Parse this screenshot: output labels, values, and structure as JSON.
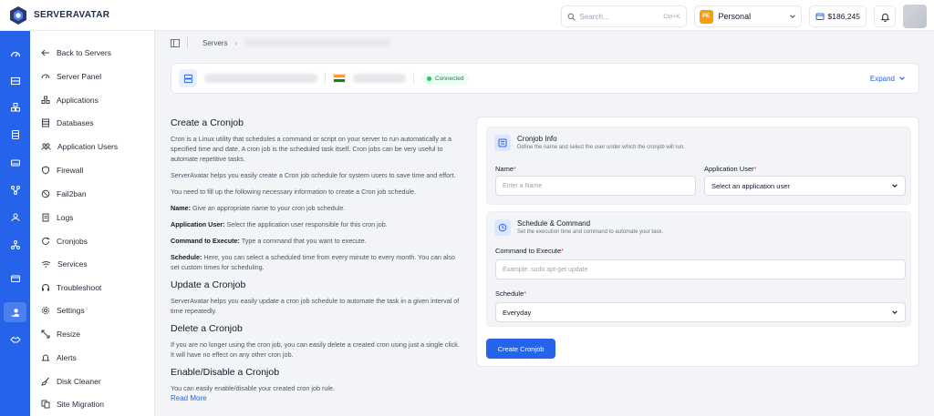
{
  "brand": {
    "name": "SERVERAVATAR"
  },
  "header": {
    "search_placeholder": "Search...",
    "search_shortcut": "Ctrl+K",
    "workspace_badge": "PE",
    "workspace_name": "Personal",
    "balance": "$186,245"
  },
  "rail": {
    "icons": [
      "dashboard-icon",
      "servers-icon",
      "applications-icon",
      "databases-icon",
      "storage-icon",
      "integrations-icon",
      "team-icon",
      "network-icon",
      "billing-icon",
      "support-icon",
      "handshake-icon"
    ],
    "active_index": 9
  },
  "sidebar": {
    "items": [
      {
        "label": "Back to Servers",
        "icon": "arrow-left-icon"
      },
      {
        "label": "Server Panel",
        "icon": "dashboard-icon"
      },
      {
        "label": "Applications",
        "icon": "applications-icon"
      },
      {
        "label": "Databases",
        "icon": "database-icon"
      },
      {
        "label": "Application Users",
        "icon": "users-icon"
      },
      {
        "label": "Firewall",
        "icon": "shield-icon"
      },
      {
        "label": "Fail2ban",
        "icon": "ban-icon"
      },
      {
        "label": "Logs",
        "icon": "logs-icon"
      },
      {
        "label": "Cronjobs",
        "icon": "cron-icon"
      },
      {
        "label": "Services",
        "icon": "services-icon"
      },
      {
        "label": "Troubleshoot",
        "icon": "headset-icon"
      },
      {
        "label": "Settings",
        "icon": "gear-icon"
      },
      {
        "label": "Resize",
        "icon": "resize-icon"
      },
      {
        "label": "Alerts",
        "icon": "bell-icon"
      },
      {
        "label": "Disk Cleaner",
        "icon": "broom-icon"
      },
      {
        "label": "Site Migration",
        "icon": "migration-icon"
      }
    ]
  },
  "breadcrumb": {
    "servers": "Servers"
  },
  "server": {
    "status": "Connected",
    "expand": "Expand"
  },
  "info": {
    "create_title": "Create a Cronjob",
    "create_p1": "Cron is a Linux utility that schedules a command or script on your server to run automatically at a specified time and date. A cron job is the scheduled task itself. Cron jobs can be very useful to automate repetitive tasks.",
    "create_p2": "ServerAvatar helps you easily create a Cron job schedule for system users to save time and effort.",
    "create_p3": "You need to fill up the following necessary information to create a Cron job schedule.",
    "name_term": "Name:",
    "name_desc": " Give an appropriate name to your cron job schedule.",
    "user_term": "Application User:",
    "user_desc": " Select the application user responsible for this cron job.",
    "cmd_term": "Command to Execute:",
    "cmd_desc": " Type a command that you want to execute.",
    "sched_term": "Schedule:",
    "sched_desc": " Here, you can select a scheduled time from every minute to every month. You can also set custom times for scheduling.",
    "update_title": "Update a Cronjob",
    "update_p": "ServerAvatar helps you easily update a cron job schedule to automate the task in a given interval of time repeatedly.",
    "delete_title": "Delete a Cronjob",
    "delete_p": "If you are no longer using the cron job, you can easily delete a created cron using just a single click. It will have no effect on any other cron job.",
    "toggle_title": "Enable/Disable a Cronjob",
    "toggle_p": "You can easily enable/disable your created cron job rule.",
    "read_more": "Read More"
  },
  "form": {
    "info_title": "Cronjob Info",
    "info_sub": "Define the name and select the user under which the cronjob will run.",
    "name_label": "Name",
    "name_placeholder": "Enter a Name",
    "user_label": "Application User",
    "user_value": "Select an application user",
    "sched_title": "Schedule & Command",
    "sched_sub": "Set the execution time and command to automate your task.",
    "cmd_label": "Command to Execute",
    "cmd_placeholder": "Example: sudo apt-get update",
    "schedule_label": "Schedule",
    "schedule_value": "Everyday",
    "required_mark": "*",
    "submit": "Create Cronjob"
  },
  "colors": {
    "accent": "#2563eb",
    "success": "#22c55e",
    "danger": "#ef4444"
  }
}
